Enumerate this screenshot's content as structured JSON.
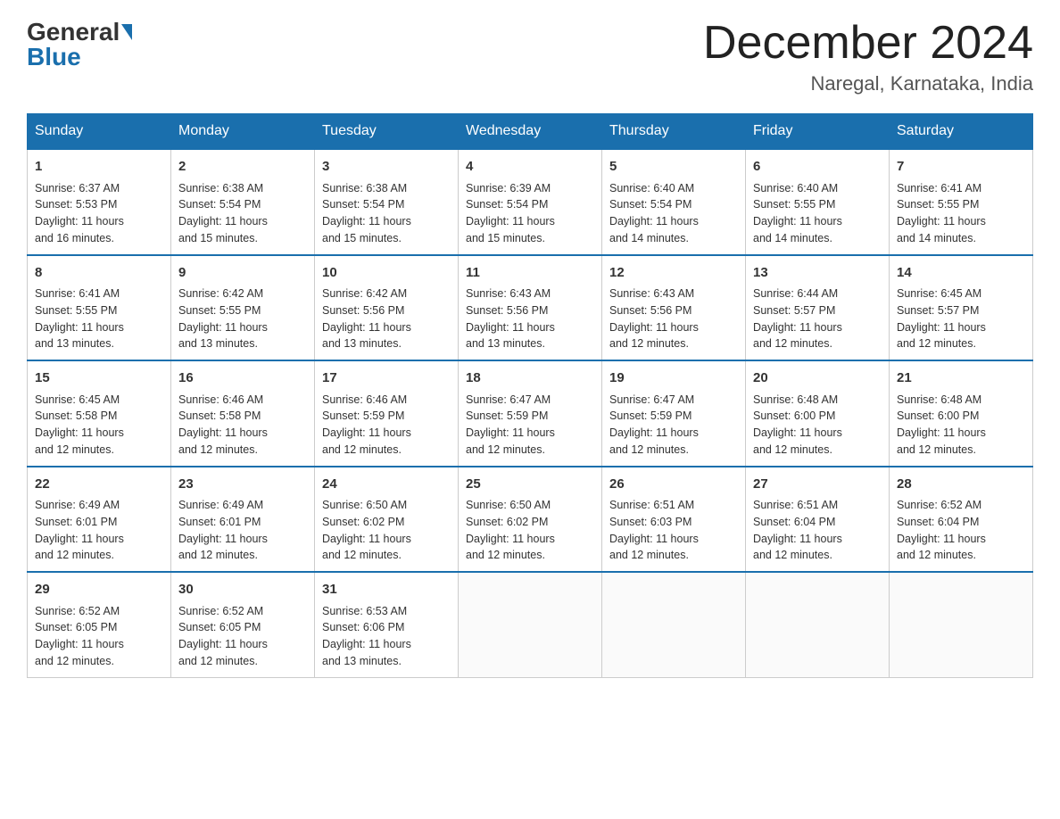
{
  "header": {
    "logo_general": "General",
    "logo_blue": "Blue",
    "month_title": "December 2024",
    "location": "Naregal, Karnataka, India"
  },
  "days_of_week": [
    "Sunday",
    "Monday",
    "Tuesday",
    "Wednesday",
    "Thursday",
    "Friday",
    "Saturday"
  ],
  "weeks": [
    [
      {
        "day": "1",
        "sunrise": "6:37 AM",
        "sunset": "5:53 PM",
        "daylight": "11 hours and 16 minutes."
      },
      {
        "day": "2",
        "sunrise": "6:38 AM",
        "sunset": "5:54 PM",
        "daylight": "11 hours and 15 minutes."
      },
      {
        "day": "3",
        "sunrise": "6:38 AM",
        "sunset": "5:54 PM",
        "daylight": "11 hours and 15 minutes."
      },
      {
        "day": "4",
        "sunrise": "6:39 AM",
        "sunset": "5:54 PM",
        "daylight": "11 hours and 15 minutes."
      },
      {
        "day": "5",
        "sunrise": "6:40 AM",
        "sunset": "5:54 PM",
        "daylight": "11 hours and 14 minutes."
      },
      {
        "day": "6",
        "sunrise": "6:40 AM",
        "sunset": "5:55 PM",
        "daylight": "11 hours and 14 minutes."
      },
      {
        "day": "7",
        "sunrise": "6:41 AM",
        "sunset": "5:55 PM",
        "daylight": "11 hours and 14 minutes."
      }
    ],
    [
      {
        "day": "8",
        "sunrise": "6:41 AM",
        "sunset": "5:55 PM",
        "daylight": "11 hours and 13 minutes."
      },
      {
        "day": "9",
        "sunrise": "6:42 AM",
        "sunset": "5:55 PM",
        "daylight": "11 hours and 13 minutes."
      },
      {
        "day": "10",
        "sunrise": "6:42 AM",
        "sunset": "5:56 PM",
        "daylight": "11 hours and 13 minutes."
      },
      {
        "day": "11",
        "sunrise": "6:43 AM",
        "sunset": "5:56 PM",
        "daylight": "11 hours and 13 minutes."
      },
      {
        "day": "12",
        "sunrise": "6:43 AM",
        "sunset": "5:56 PM",
        "daylight": "11 hours and 12 minutes."
      },
      {
        "day": "13",
        "sunrise": "6:44 AM",
        "sunset": "5:57 PM",
        "daylight": "11 hours and 12 minutes."
      },
      {
        "day": "14",
        "sunrise": "6:45 AM",
        "sunset": "5:57 PM",
        "daylight": "11 hours and 12 minutes."
      }
    ],
    [
      {
        "day": "15",
        "sunrise": "6:45 AM",
        "sunset": "5:58 PM",
        "daylight": "11 hours and 12 minutes."
      },
      {
        "day": "16",
        "sunrise": "6:46 AM",
        "sunset": "5:58 PM",
        "daylight": "11 hours and 12 minutes."
      },
      {
        "day": "17",
        "sunrise": "6:46 AM",
        "sunset": "5:59 PM",
        "daylight": "11 hours and 12 minutes."
      },
      {
        "day": "18",
        "sunrise": "6:47 AM",
        "sunset": "5:59 PM",
        "daylight": "11 hours and 12 minutes."
      },
      {
        "day": "19",
        "sunrise": "6:47 AM",
        "sunset": "5:59 PM",
        "daylight": "11 hours and 12 minutes."
      },
      {
        "day": "20",
        "sunrise": "6:48 AM",
        "sunset": "6:00 PM",
        "daylight": "11 hours and 12 minutes."
      },
      {
        "day": "21",
        "sunrise": "6:48 AM",
        "sunset": "6:00 PM",
        "daylight": "11 hours and 12 minutes."
      }
    ],
    [
      {
        "day": "22",
        "sunrise": "6:49 AM",
        "sunset": "6:01 PM",
        "daylight": "11 hours and 12 minutes."
      },
      {
        "day": "23",
        "sunrise": "6:49 AM",
        "sunset": "6:01 PM",
        "daylight": "11 hours and 12 minutes."
      },
      {
        "day": "24",
        "sunrise": "6:50 AM",
        "sunset": "6:02 PM",
        "daylight": "11 hours and 12 minutes."
      },
      {
        "day": "25",
        "sunrise": "6:50 AM",
        "sunset": "6:02 PM",
        "daylight": "11 hours and 12 minutes."
      },
      {
        "day": "26",
        "sunrise": "6:51 AM",
        "sunset": "6:03 PM",
        "daylight": "11 hours and 12 minutes."
      },
      {
        "day": "27",
        "sunrise": "6:51 AM",
        "sunset": "6:04 PM",
        "daylight": "11 hours and 12 minutes."
      },
      {
        "day": "28",
        "sunrise": "6:52 AM",
        "sunset": "6:04 PM",
        "daylight": "11 hours and 12 minutes."
      }
    ],
    [
      {
        "day": "29",
        "sunrise": "6:52 AM",
        "sunset": "6:05 PM",
        "daylight": "11 hours and 12 minutes."
      },
      {
        "day": "30",
        "sunrise": "6:52 AM",
        "sunset": "6:05 PM",
        "daylight": "11 hours and 12 minutes."
      },
      {
        "day": "31",
        "sunrise": "6:53 AM",
        "sunset": "6:06 PM",
        "daylight": "11 hours and 13 minutes."
      },
      null,
      null,
      null,
      null
    ]
  ]
}
